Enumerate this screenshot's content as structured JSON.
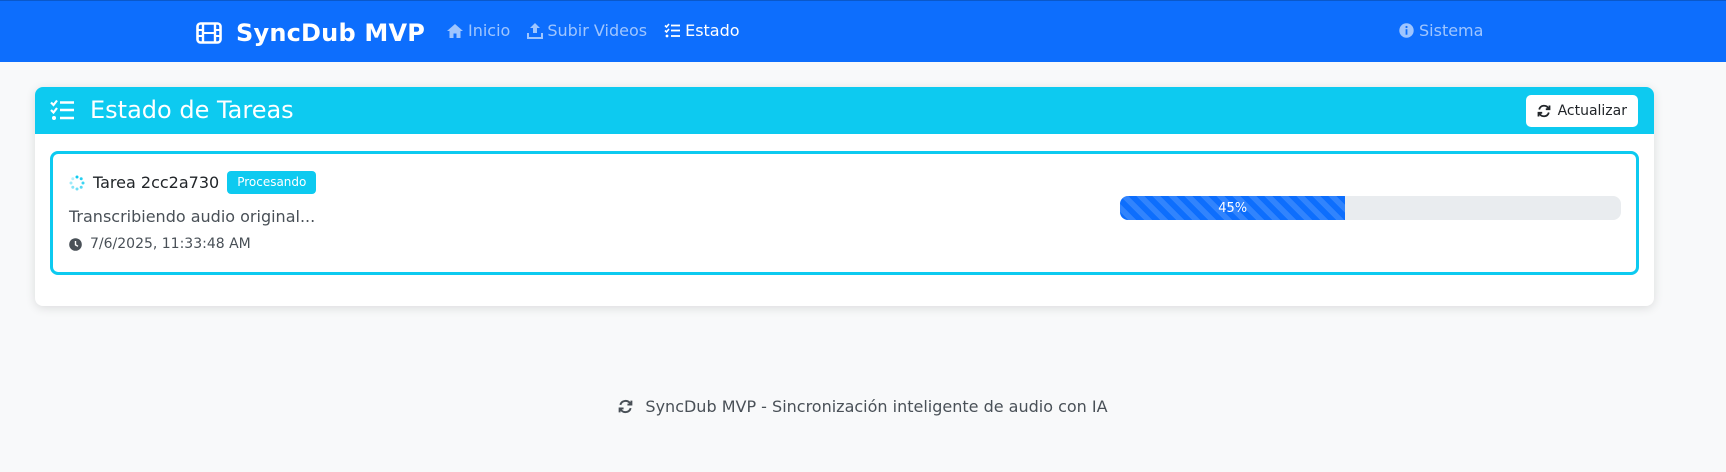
{
  "colors": {
    "navbar": "#0d6efd",
    "card_header": "#0dcaf0",
    "progress": "#0d6efd",
    "badge": "#0dcaf0"
  },
  "navbar": {
    "brand_icon": "film-icon",
    "brand": "SyncDub MVP",
    "links": [
      {
        "icon": "home-icon",
        "label": "Inicio",
        "active": false
      },
      {
        "icon": "upload-icon",
        "label": "Subir Videos",
        "active": false
      },
      {
        "icon": "list-check-icon",
        "label": "Estado",
        "active": true
      }
    ],
    "right": {
      "icon": "info-circle-icon",
      "label": "Sistema"
    }
  },
  "panel": {
    "icon": "list-check-icon",
    "title": "Estado de Tareas",
    "refresh_icon": "sync-icon",
    "refresh_label": "Actualizar"
  },
  "tasks": [
    {
      "icon": "spinner-icon",
      "name": "Tarea 2cc2a730",
      "status": "Procesando",
      "description": "Transcribiendo audio original...",
      "time_icon": "clock-icon",
      "timestamp": "7/6/2025, 11:33:48 AM",
      "progress": 45,
      "progress_label": "45%"
    }
  ],
  "footer": {
    "icon": "sync-icon",
    "text": "SyncDub MVP - Sincronización inteligente de audio con IA"
  }
}
